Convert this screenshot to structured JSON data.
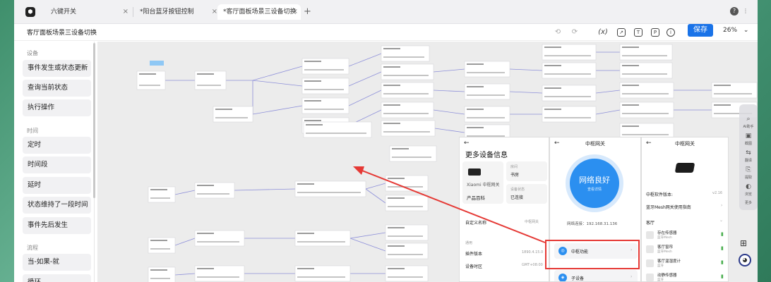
{
  "tabs": [
    {
      "label": "六键开关",
      "active": false
    },
    {
      "label": "*阳台蓝牙按钮控制",
      "active": false
    },
    {
      "label": "*客厅面板场景三设备切换",
      "active": true
    }
  ],
  "toolbar": {
    "doc_title": "客厅面板场景三设备切换",
    "undo": "⟲",
    "redo": "⟳",
    "var_label": "(x)",
    "save_label": "保存",
    "zoom": "26%"
  },
  "sidebar": {
    "section_device": "设备",
    "items_device": [
      "事件发生或状态更新",
      "查询当前状态",
      "执行操作"
    ],
    "section_time": "时间",
    "items_time": [
      "定时",
      "时间段",
      "延时",
      "状态维持了一段时间",
      "事件先后发生"
    ],
    "section_flow": "流程",
    "items_flow": [
      "当-如果-就",
      "循环"
    ]
  },
  "panel1": {
    "title": "更多设备信息",
    "gateway": "Xiaomi 中枢网关",
    "room_label": "房间",
    "room_value": "书房",
    "product": "产品百科",
    "status_label": "设备状态",
    "status_value": "已连接",
    "custom_name": "自定义名称",
    "custom_name_value": "中枢网关",
    "section": "通用",
    "plugin_version": "插件版本",
    "plugin_version_value": "1890.4.15.0",
    "timezone": "设备时区",
    "timezone_value": "GMT+08:00"
  },
  "panel2": {
    "title": "中枢网关",
    "circle_text": "网络良好",
    "circle_sub": "查看详情",
    "network": "网络连接：192.168.31.136",
    "feature1": "中枢功能",
    "feature2": "子设备"
  },
  "panel3": {
    "title": "中枢网关",
    "software_version": "中枢软件版本:",
    "software_version_value": "v2.16",
    "mesh_guide": "蓝牙Mesh网关使用指南",
    "room": "客厅",
    "devices": [
      {
        "name": "存在传感器",
        "sub": "蓝牙Mesh"
      },
      {
        "name": "客厅窗帘",
        "sub": "蓝牙Mesh"
      },
      {
        "name": "客厅温湿度计",
        "sub": "蓝牙"
      },
      {
        "name": "动静传感器",
        "sub": "蓝牙"
      }
    ]
  },
  "rail": [
    "AI助手",
    "截图",
    "翻译",
    "提取",
    "浏览",
    "更多"
  ],
  "colors": {
    "accent": "#1a73e8",
    "arrow": "#e53935",
    "highlight": "#e53935",
    "circle": "#2b8ff0"
  }
}
